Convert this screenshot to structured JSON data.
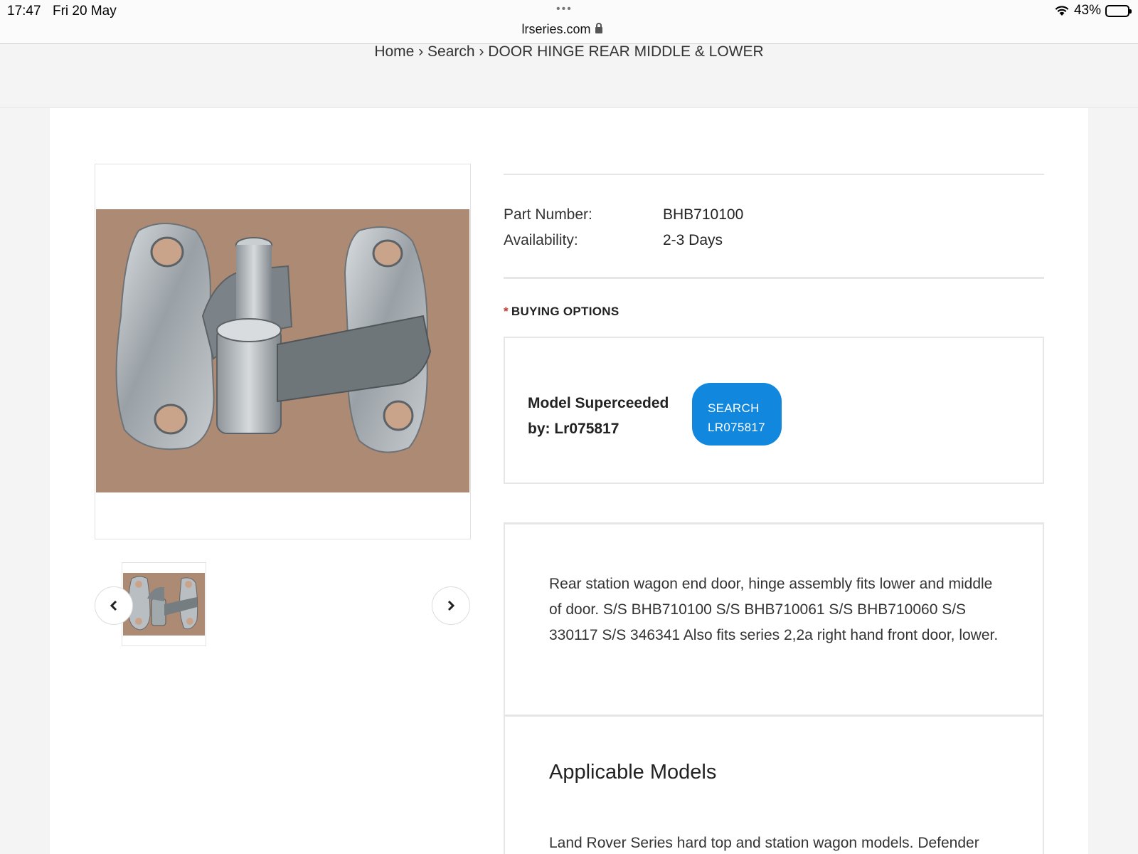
{
  "status_bar": {
    "time": "17:47",
    "date": "Fri 20 May",
    "battery_percent": "43%",
    "battery_level": 0.43
  },
  "browser": {
    "dots": "•••",
    "url": "lrseries.com"
  },
  "breadcrumb": {
    "items": [
      "Home",
      "Search",
      "DOOR HINGE REAR MIDDLE & LOWER"
    ],
    "separator": "›"
  },
  "product": {
    "image_alt_icon": "door-hinge-photo",
    "specs": [
      {
        "label": "Part Number:",
        "value": "BHB710100"
      },
      {
        "label": "Availability:",
        "value": "2-3 Days"
      }
    ]
  },
  "buying_options": {
    "required_marker": "*",
    "title": "BUYING OPTIONS",
    "superseded_line1": "Model Superceeded",
    "superseded_line2": "by: Lr075817",
    "search_button_line1": "SEARCH",
    "search_button_line2": "LR075817",
    "button_color": "#1187de"
  },
  "description": {
    "text": "Rear station wagon end door, hinge assembly fits lower and middle of door. S/S BHB710100 S/S BHB710061 S/S BHB710060 S/S 330117 S/S 346341 Also fits series 2,2a right hand front door, lower."
  },
  "applicable_models": {
    "title": "Applicable Models",
    "text": "Land Rover Series hard top and station wagon models. Defender"
  }
}
